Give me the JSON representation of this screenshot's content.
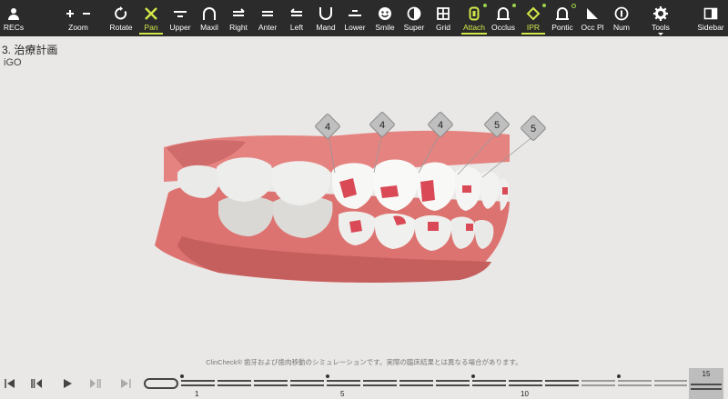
{
  "toolbar": {
    "recs": "RECs",
    "zoom": "Zoom",
    "rotate": "Rotate",
    "pan": "Pan",
    "upper": "Upper",
    "maxil": "Maxil",
    "right": "Right",
    "anter": "Anter",
    "left": "Left",
    "mand": "Mand",
    "lower": "Lower",
    "smile": "Smile",
    "super": "Super",
    "grid": "Grid",
    "attach": "Attach",
    "occlus": "Occlus",
    "ipr": "IPR",
    "pontic": "Pontic",
    "occpl": "Occ Pl",
    "num": "Num",
    "tools": "Tools",
    "sidebar": "Sidebar",
    "active_color": "#d4e84a"
  },
  "patient": {
    "title": "3. 治療計画",
    "subtitle": "iGO"
  },
  "viewer": {
    "markers": [
      "4",
      "4",
      "4",
      "5",
      "5"
    ],
    "gum_color": "#e07a78",
    "tooth_color": "#f4f4f2",
    "attachment_color": "#d94a56"
  },
  "disclaimer": "ClinCheck® 歯牙および歯肉移動のシミュレーションです。実際の臨床結果とは異なる場合があります。",
  "timeline": {
    "labels": [
      "1",
      "5",
      "10"
    ],
    "current_stage": "15"
  }
}
